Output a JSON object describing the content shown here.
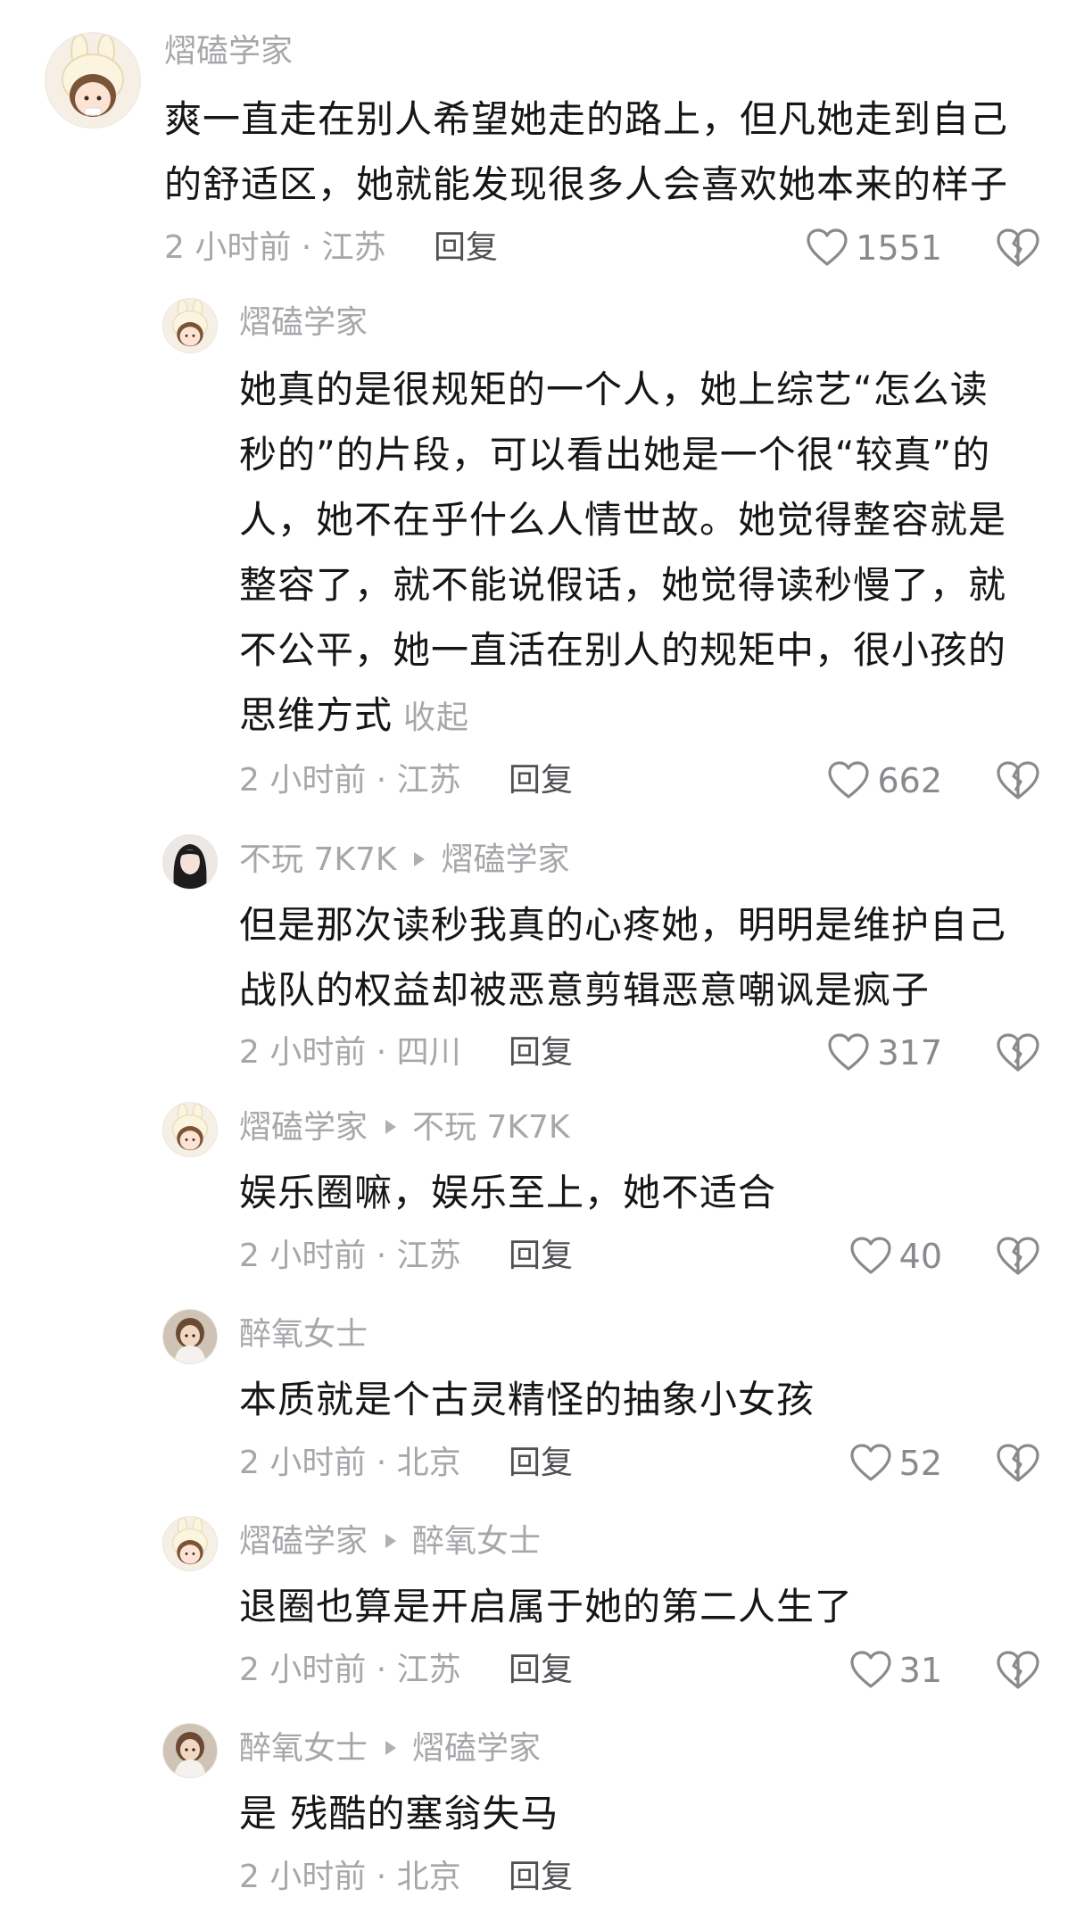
{
  "comments": [
    {
      "author": "熠磕学家",
      "reply_to": "",
      "lines": [
        "爽一直走在别人希望她走的路上，但凡她走到自己",
        "的舒适区，她就能发现很多人会喜欢她本来的样子"
      ],
      "time_location": "2 小时前 · 江苏",
      "reply_label": "回复",
      "likes": "1551",
      "avatar": "bunny-hat-girl"
    },
    {
      "author": "熠磕学家",
      "reply_to": "",
      "lines": [
        "她真的是很规矩的一个人，她上综艺“怎么读",
        "秒的”的片段，可以看出她是一个很“较真”的",
        "人，她不在乎什么人情世故。她觉得整容就是",
        "整容了，就不能说假话，她觉得读秒慢了，就",
        "不公平，她一直活在别人的规矩中，很小孩的",
        "思维方式"
      ],
      "collapse_label": "收起",
      "time_location": "2 小时前 · 江苏",
      "reply_label": "回复",
      "likes": "662",
      "avatar": "bunny-hat-girl"
    },
    {
      "author": "不玩 7K7K",
      "reply_to": "熠磕学家",
      "lines": [
        "但是那次读秒我真的心疼她，明明是维护自己",
        "战队的权益却被恶意剪辑恶意嘲讽是疯子"
      ],
      "time_location": "2 小时前 · 四川",
      "reply_label": "回复",
      "likes": "317",
      "avatar": "dark-hair-girl"
    },
    {
      "author": "熠磕学家",
      "reply_to": "不玩 7K7K",
      "lines": [
        "娱乐圈嘛，娱乐至上，她不适合"
      ],
      "time_location": "2 小时前 · 江苏",
      "reply_label": "回复",
      "likes": "40",
      "avatar": "bunny-hat-girl"
    },
    {
      "author": "醉氧女士",
      "reply_to": "",
      "lines": [
        "本质就是个古灵精怪的抽象小女孩"
      ],
      "time_location": "2 小时前 · 北京",
      "reply_label": "回复",
      "likes": "52",
      "avatar": "photo-girl"
    },
    {
      "author": "熠磕学家",
      "reply_to": "醉氧女士",
      "lines": [
        "退圈也算是开启属于她的第二人生了"
      ],
      "time_location": "2 小时前 · 江苏",
      "reply_label": "回复",
      "likes": "31",
      "avatar": "bunny-hat-girl"
    },
    {
      "author": "醉氧女士",
      "reply_to": "熠磕学家",
      "lines": [
        "是 残酷的塞翁失马"
      ],
      "time_location": "2 小时前 · 北京",
      "reply_label": "回复",
      "likes": "",
      "avatar": "photo-girl"
    }
  ],
  "icons": {
    "like": "heart-outline-icon",
    "dislike": "broken-heart-icon",
    "reply_arrow": "triangle-right-icon"
  },
  "colors": {
    "text": "#161616",
    "secondary": "#a7a7ab",
    "reply": "#505055",
    "icon": "#8a8a8e"
  }
}
